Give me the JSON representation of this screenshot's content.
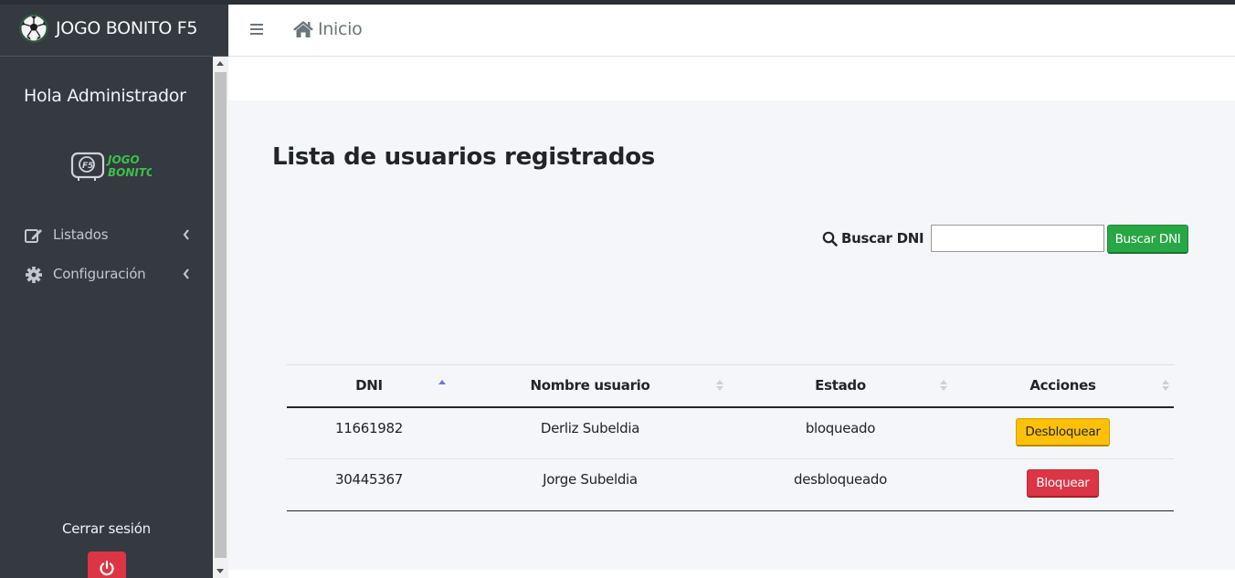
{
  "brand": {
    "title": "JOGO BONITO F5",
    "logo_icon": "soccer-ball-icon"
  },
  "sidebar": {
    "greeting": "Hola Administrador",
    "logo": {
      "badge": "F5",
      "line1": "JOGO",
      "line2": "BONITO"
    },
    "items": [
      {
        "label": "Listados",
        "icon": "edit-icon"
      },
      {
        "label": "Configuración",
        "icon": "gear-icon"
      }
    ],
    "logout_label": "Cerrar sesión",
    "logout_icon": "power-icon"
  },
  "navbar": {
    "menu_icon": "hamburger-icon",
    "home_label": "Inicio",
    "home_icon": "home-icon"
  },
  "main": {
    "title": "Lista de usuarios registrados",
    "search": {
      "label": "Buscar DNI",
      "value": "",
      "button": "Buscar DNI"
    },
    "table": {
      "headers": [
        "DNI",
        "Nombre usuario",
        "Estado",
        "Acciones"
      ],
      "rows": [
        {
          "dni": "11661982",
          "nombre": "Derliz Subeldia",
          "estado": "bloqueado",
          "accion": "Desbloquear"
        },
        {
          "dni": "30445367",
          "nombre": "Jorge Subeldia",
          "estado": "desbloqueado",
          "accion": "Bloquear"
        }
      ]
    }
  },
  "colors": {
    "sidebar": "#343a40",
    "success": "#28a745",
    "warning": "#ffc107",
    "danger": "#dc3545",
    "sort_active": "#6f7ad3"
  }
}
